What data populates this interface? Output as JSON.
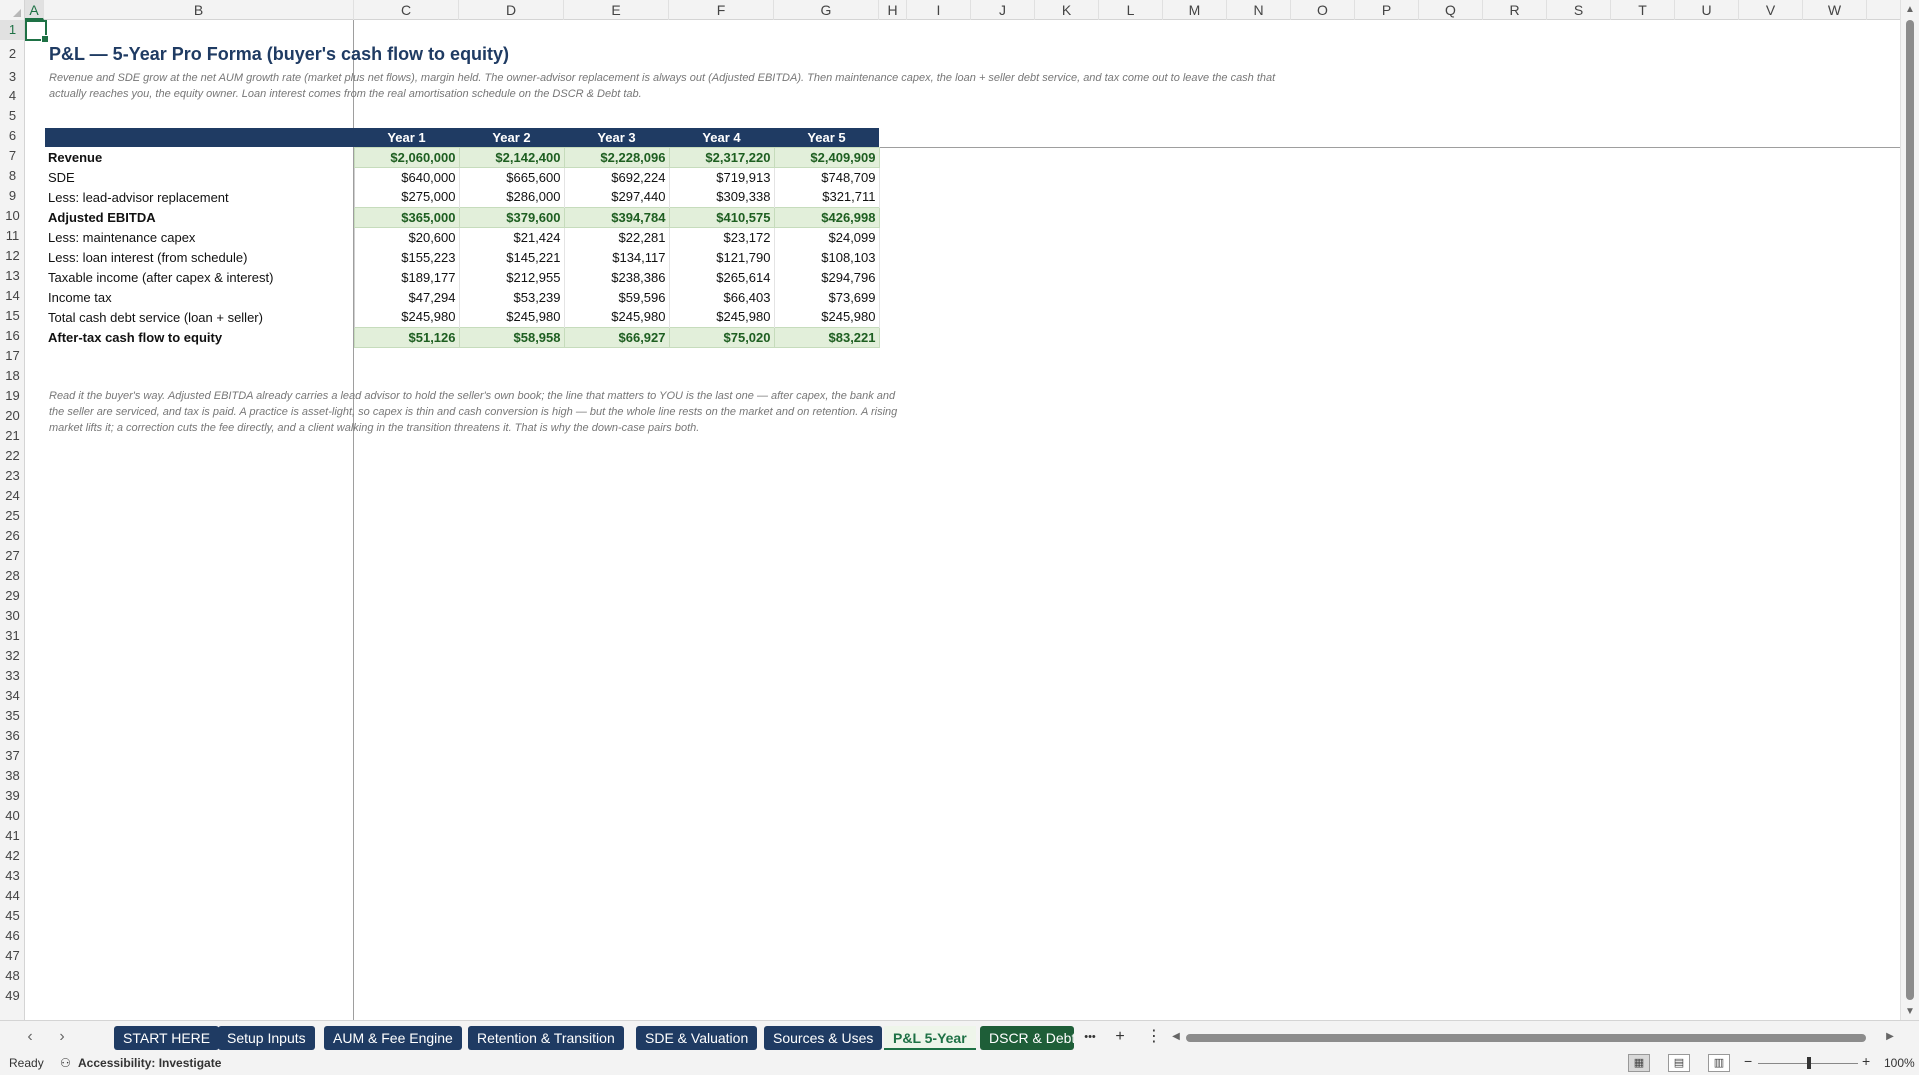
{
  "columns": [
    "A",
    "B",
    "C",
    "D",
    "E",
    "F",
    "G",
    "H",
    "I",
    "J",
    "K",
    "L",
    "M",
    "N",
    "O",
    "P",
    "Q",
    "R",
    "S",
    "T",
    "U",
    "V",
    "W"
  ],
  "rows": [
    "1",
    "2",
    "3",
    "4",
    "5",
    "6",
    "7",
    "8",
    "9",
    "10",
    "11",
    "12",
    "13",
    "14",
    "15",
    "16",
    "17",
    "18",
    "19",
    "20",
    "21",
    "22",
    "23",
    "24",
    "25",
    "26",
    "27",
    "28",
    "29",
    "30",
    "31",
    "32",
    "33",
    "34",
    "35",
    "36",
    "37",
    "38",
    "39",
    "40",
    "41",
    "42",
    "43",
    "44",
    "45",
    "46",
    "47",
    "48",
    "49"
  ],
  "sheet": {
    "title": "P&L — 5-Year Pro Forma (buyer's cash flow to equity)",
    "subtitle": "Revenue and SDE grow at the net AUM growth rate (market plus net flows), margin held. The owner-advisor replacement is always out (Adjusted EBITDA). Then maintenance capex, the loan + seller debt service, and tax come out to leave the cash that actually reaches you, the equity owner. Loan interest comes from the real amortisation schedule on the DSCR & Debt tab.",
    "note": "Read it the buyer's way. Adjusted EBITDA already carries a lead advisor to hold the seller's own book; the line that matters to YOU is the last one — after capex, the bank and the seller are serviced, and tax is paid. A practice is asset-light, so capex is thin and cash conversion is high — but the whole line rests on the market and on retention. A rising market lifts it; a correction cuts the fee directly, and a client walking in the transition threatens it. That is why the down-case pairs both."
  },
  "table": {
    "years": [
      "Year 1",
      "Year 2",
      "Year 3",
      "Year 4",
      "Year 5"
    ],
    "rows": [
      {
        "label": "Revenue",
        "values": [
          "$2,060,000",
          "$2,142,400",
          "$2,228,096",
          "$2,317,220",
          "$2,409,909"
        ]
      },
      {
        "label": "SDE",
        "values": [
          "$640,000",
          "$665,600",
          "$692,224",
          "$719,913",
          "$748,709"
        ]
      },
      {
        "label": "Less: lead-advisor replacement",
        "values": [
          "$275,000",
          "$286,000",
          "$297,440",
          "$309,338",
          "$321,711"
        ]
      },
      {
        "label": "Adjusted EBITDA",
        "values": [
          "$365,000",
          "$379,600",
          "$394,784",
          "$410,575",
          "$426,998"
        ]
      },
      {
        "label": "Less: maintenance capex",
        "values": [
          "$20,600",
          "$21,424",
          "$22,281",
          "$23,172",
          "$24,099"
        ]
      },
      {
        "label": "Less: loan interest (from schedule)",
        "values": [
          "$155,223",
          "$145,221",
          "$134,117",
          "$121,790",
          "$108,103"
        ]
      },
      {
        "label": "Taxable income (after capex & interest)",
        "values": [
          "$189,177",
          "$212,955",
          "$238,386",
          "$265,614",
          "$294,796"
        ]
      },
      {
        "label": "Income tax",
        "values": [
          "$47,294",
          "$53,239",
          "$59,596",
          "$66,403",
          "$73,699"
        ]
      },
      {
        "label": "Total cash debt service (loan + seller)",
        "values": [
          "$245,980",
          "$245,980",
          "$245,980",
          "$245,980",
          "$245,980"
        ]
      },
      {
        "label": "After-tax cash flow to equity",
        "values": [
          "$51,126",
          "$58,958",
          "$66,927",
          "$75,020",
          "$83,221"
        ]
      }
    ]
  },
  "tabs": [
    "START HERE",
    "Setup Inputs",
    "AUM & Fee Engine",
    "Retention & Transition",
    "SDE & Valuation",
    "Sources & Uses",
    "P&L 5-Year",
    "DSCR & Debt"
  ],
  "tab_controls": {
    "more": "•••",
    "add": "+",
    "options": "⋮"
  },
  "status": {
    "ready": "Ready",
    "accessibility": "Accessibility: Investigate",
    "zoom": "100%",
    "zoom_minus": "−",
    "zoom_plus": "+"
  },
  "colors": {
    "header_navy": "#1f3b63",
    "highlight_green": "#e2efda",
    "accent_green": "#1e7145"
  }
}
